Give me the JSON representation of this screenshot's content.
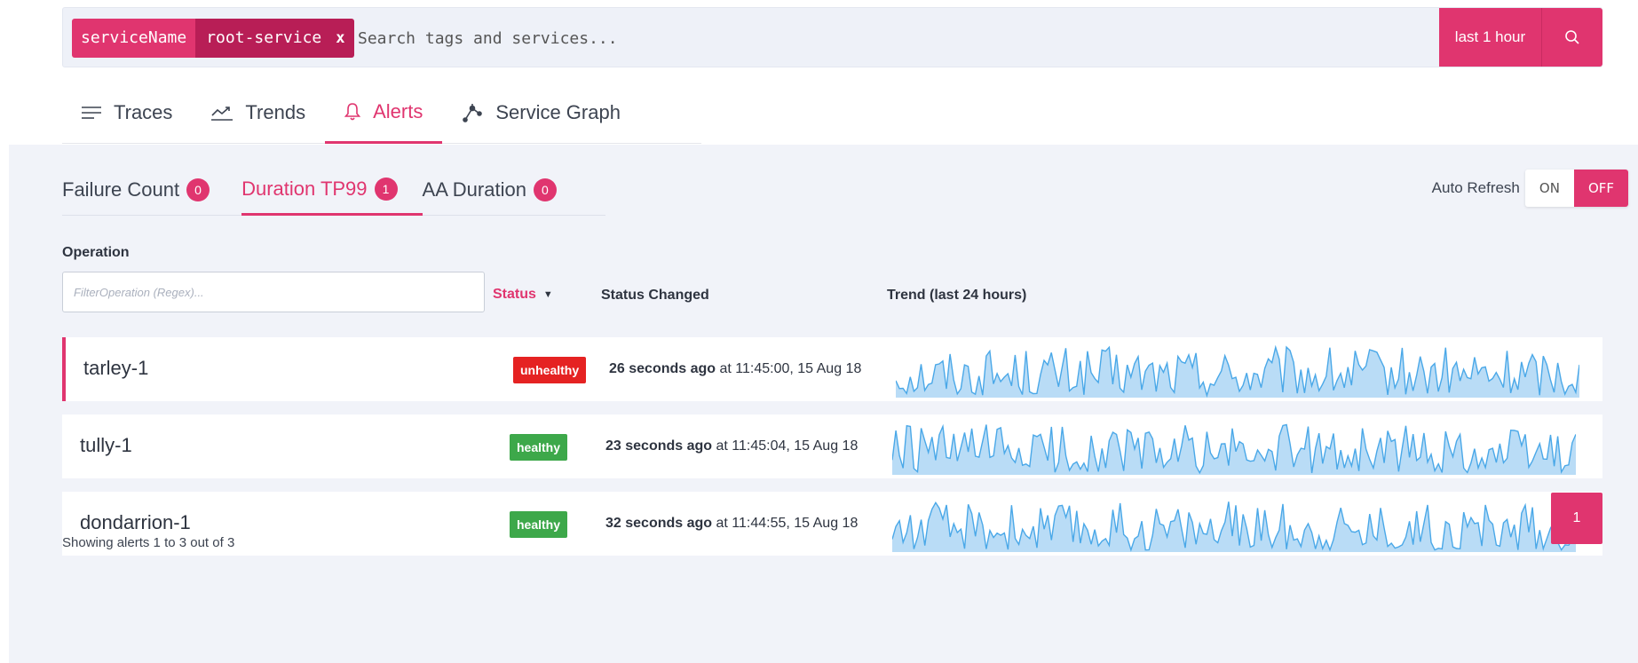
{
  "search": {
    "chip_key": "serviceName",
    "chip_value": "root-service",
    "chip_remove": "x",
    "placeholder": "Search tags and services...",
    "time_range": "last 1 hour",
    "search_icon": "search-icon"
  },
  "main_tabs": [
    {
      "label": "Traces",
      "icon": "list-icon",
      "active": false
    },
    {
      "label": "Trends",
      "icon": "trend-icon",
      "active": false
    },
    {
      "label": "Alerts",
      "icon": "bell-icon",
      "active": true
    },
    {
      "label": "Service Graph",
      "icon": "graph-icon",
      "active": false
    }
  ],
  "sub_tabs": [
    {
      "label": "Failure Count",
      "count": "0",
      "active": false
    },
    {
      "label": "Duration TP99",
      "count": "1",
      "active": true
    },
    {
      "label": "AA Duration",
      "count": "0",
      "active": false
    }
  ],
  "auto_refresh": {
    "label": "Auto Refresh",
    "on": "ON",
    "off": "OFF",
    "state": "OFF"
  },
  "table": {
    "operation_label": "Operation",
    "filter_placeholder": "FilterOperation (Regex)...",
    "col_status": "Status",
    "col_changed": "Status Changed",
    "col_trend": "Trend (last 24 hours)",
    "rows": [
      {
        "name": "tarley-1",
        "status": "unhealthy",
        "ago": "26 seconds ago",
        "at": " at 11:45:00, 15 Aug 18"
      },
      {
        "name": "tully-1",
        "status": "healthy",
        "ago": "23 seconds ago",
        "at": " at 11:45:04, 15 Aug 18"
      },
      {
        "name": "dondarrion-1",
        "status": "healthy",
        "ago": "32 seconds ago",
        "at": " at 11:44:55, 15 Aug 18"
      }
    ]
  },
  "footer": {
    "showing": "Showing alerts 1 to 3 out of 3",
    "page": "1"
  },
  "colors": {
    "accent": "#e0356f",
    "unhealthy": "#e52222",
    "healthy": "#3da84a",
    "sparkline": "#4aa8e8"
  }
}
